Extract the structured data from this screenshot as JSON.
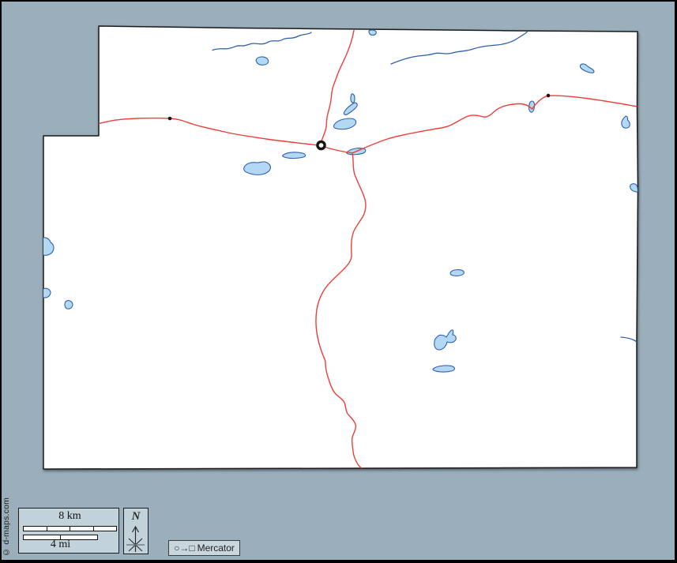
{
  "canvas": {
    "background_color": "#9aaebb",
    "frame_color": "#000000"
  },
  "map": {
    "land_color": "#ffffff",
    "outline_color": "#1a1a1a",
    "road_color": "#ee3e3a",
    "water_fill_color": "#b3d8f4",
    "water_stroke_color": "#3060ae",
    "marker_color": "#141414",
    "features": {
      "roads": 4,
      "rivers": 3,
      "lakes": 18,
      "town_markers": 1,
      "place_dots": 2
    }
  },
  "legend": {
    "scale": {
      "km_label": "8 km",
      "mi_label": "4 mi",
      "km_segments": 4,
      "mi_segments": 2
    },
    "north": {
      "label": "N"
    },
    "projection": {
      "symbols": "○→□",
      "label": "Mercator"
    }
  },
  "credit": {
    "text": "© d-maps.com"
  }
}
